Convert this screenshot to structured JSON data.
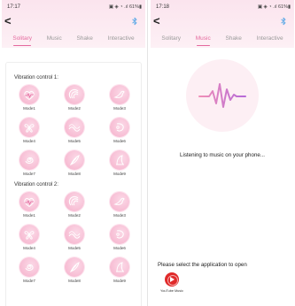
{
  "left_screen": {
    "status_time": "17:17",
    "status_icons": "▣ ◈ ◔ .ıl 61%▮",
    "back_glyph": "<",
    "tabs": [
      {
        "label": "Solitary",
        "active": true
      },
      {
        "label": "Music",
        "active": false
      },
      {
        "label": "Shake",
        "active": false
      },
      {
        "label": "Interactive",
        "active": false
      }
    ],
    "sections": [
      {
        "title": "Vibration control 1:",
        "modes": [
          {
            "label": "Mode1",
            "icon": "heart-wave-icon"
          },
          {
            "label": "Mode2",
            "icon": "ripple-icon"
          },
          {
            "label": "Mode3",
            "icon": "dolphin-icon"
          },
          {
            "label": "Mode4",
            "icon": "butterfly-icon"
          },
          {
            "label": "Mode5",
            "icon": "wave-icon"
          },
          {
            "label": "Mode6",
            "icon": "hook-icon"
          },
          {
            "label": "Mode7",
            "icon": "swirl-icon"
          },
          {
            "label": "Mode8",
            "icon": "feather-icon"
          },
          {
            "label": "Mode9",
            "icon": "sail-icon"
          }
        ]
      },
      {
        "title": "Vibration control 2:",
        "modes": [
          {
            "label": "Mode1",
            "icon": "heart-wave-icon"
          },
          {
            "label": "Mode2",
            "icon": "ripple-icon"
          },
          {
            "label": "Mode3",
            "icon": "dolphin-icon"
          },
          {
            "label": "Mode4",
            "icon": "butterfly-icon"
          },
          {
            "label": "Mode5",
            "icon": "wave-icon"
          },
          {
            "label": "Mode6",
            "icon": "hook-icon"
          },
          {
            "label": "Mode7",
            "icon": "swirl-icon"
          },
          {
            "label": "Mode8",
            "icon": "feather-icon"
          },
          {
            "label": "Mode9",
            "icon": "sail-icon"
          }
        ]
      }
    ]
  },
  "right_screen": {
    "status_time": "17:18",
    "status_icons": "▣ ◈ ◔ .ıl 61%▮",
    "back_glyph": "<",
    "tabs": [
      {
        "label": "Solitary",
        "active": false
      },
      {
        "label": "Music",
        "active": true
      },
      {
        "label": "Shake",
        "active": false
      },
      {
        "label": "Interactive",
        "active": false
      }
    ],
    "listening_text": "Listening to music on your phone...",
    "select_app_text": "Please select the application to open",
    "apps": [
      {
        "label": "YouTube Music",
        "icon": "youtube-music-icon"
      }
    ]
  },
  "colors": {
    "accent": "#e46a9e",
    "header_bg": "#fbe4ee",
    "mode_circle": "#f7bcd3",
    "waveform_start": "#f08fb7",
    "waveform_end": "#b66ad8"
  }
}
